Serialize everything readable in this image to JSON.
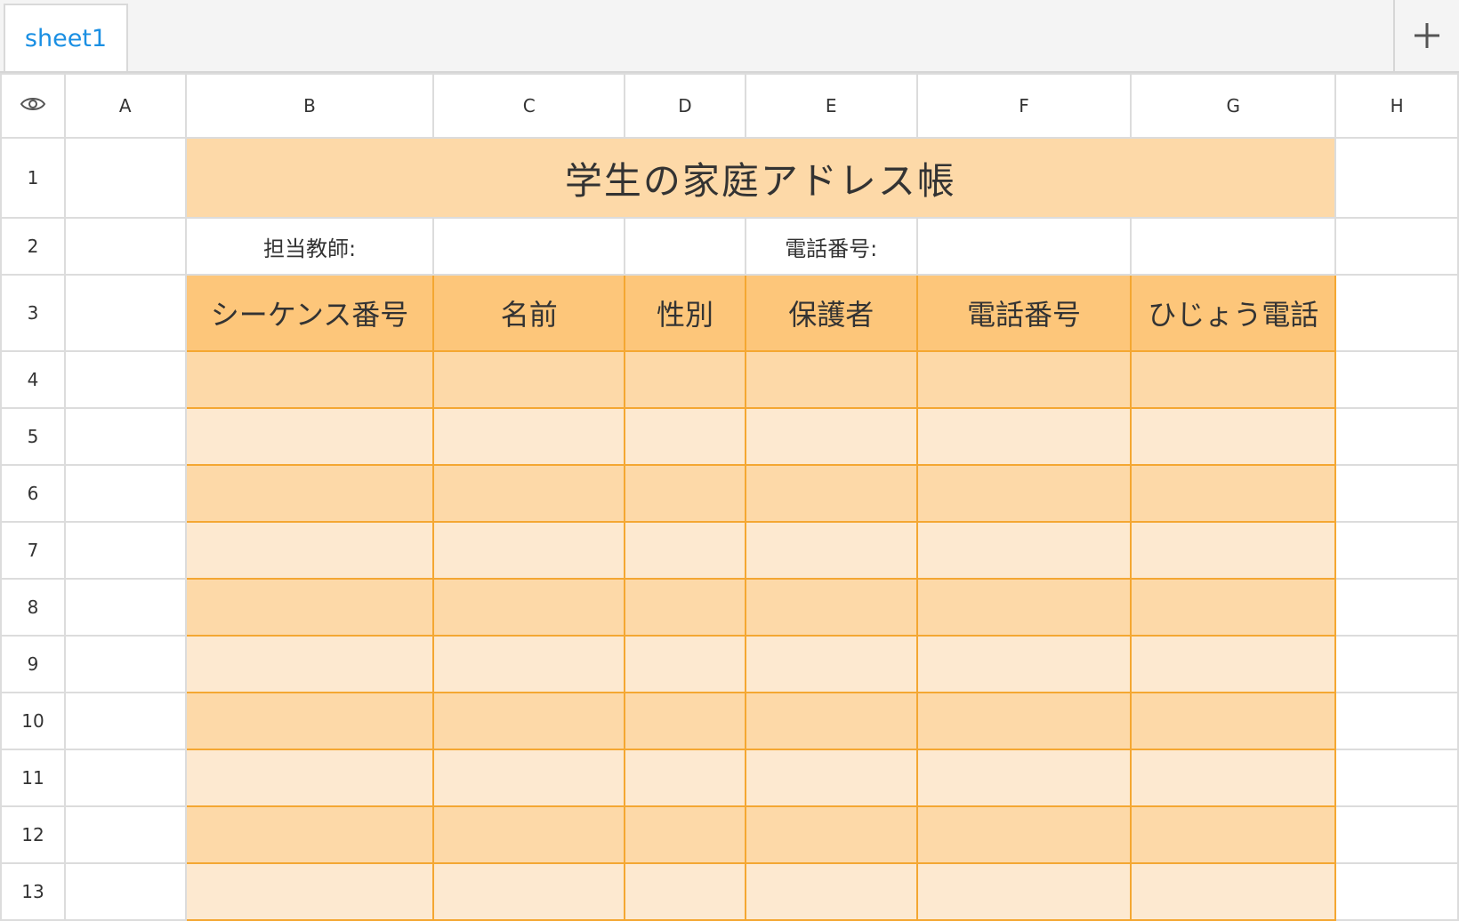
{
  "tabs": [
    {
      "label": "sheet1",
      "active": true
    }
  ],
  "add_sheet_icon": "plus-icon",
  "corner_icon": "eye-icon",
  "columns": [
    "A",
    "B",
    "C",
    "D",
    "E",
    "F",
    "G",
    "H"
  ],
  "rows": [
    "1",
    "2",
    "3",
    "4",
    "5",
    "6",
    "7",
    "8",
    "9",
    "10",
    "11",
    "12",
    "13"
  ],
  "sheet": {
    "title": "学生の家庭アドレス帳",
    "teacher_label": "担当教師:",
    "phone_label": "電話番号:",
    "headers": [
      "シーケンス番号",
      "名前",
      "性別",
      "保護者",
      "電話番号",
      "ひじょう電話"
    ]
  },
  "colors": {
    "tab_accent": "#1a8fe3",
    "title_fill": "#fdd9a8",
    "header_fill": "#fdc67a",
    "band_dark": "#fdd9a8",
    "band_light": "#fde9d0",
    "table_border": "#f4a732",
    "grid_line": "#dcdcdc"
  }
}
